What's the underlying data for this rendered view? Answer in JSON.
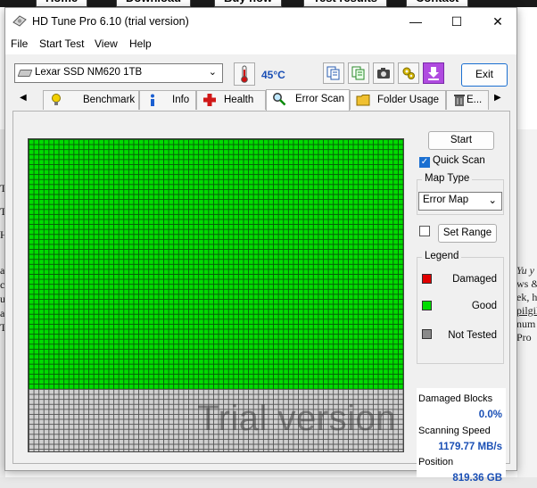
{
  "background": {
    "tabs": [
      "Home",
      "Download",
      "Buy now",
      "Test results",
      "Contact"
    ],
    "right_text": [
      "Yu y",
      "ws &",
      "ek, h",
      "pilgil",
      "num",
      "Pro"
    ],
    "left_text": [
      "T",
      "T",
      "H",
      "a",
      "c",
      "u",
      "a",
      "T"
    ]
  },
  "window": {
    "title": "HD Tune Pro 6.10 (trial version)",
    "controls": {
      "minimize": "—",
      "maximize": "☐",
      "close": "✕"
    }
  },
  "menu": [
    "File",
    "Start Test",
    "View",
    "Help"
  ],
  "toolbar": {
    "drive": "Lexar SSD NM620 1TB",
    "temperature": "45°C",
    "exit_label": "Exit"
  },
  "tabs": [
    {
      "label": "Benchmark",
      "icon": "benchmark-bulb-icon"
    },
    {
      "label": "Info",
      "icon": "info-icon"
    },
    {
      "label": "Health",
      "icon": "health-cross-icon"
    },
    {
      "label": "Error Scan",
      "icon": "magnifier-icon",
      "active": true
    },
    {
      "label": "Folder Usage",
      "icon": "folder-icon"
    },
    {
      "label": "E...",
      "icon": "trash-icon"
    }
  ],
  "error_scan": {
    "start_label": "Start",
    "quick_scan_label": "Quick Scan",
    "quick_scan_checked": true,
    "map_type_label": "Map Type",
    "map_type_value": "Error Map",
    "set_range_label": "Set Range",
    "set_range_checked": false,
    "legend_label": "Legend",
    "legend": [
      {
        "label": "Damaged",
        "color": "#e00000"
      },
      {
        "label": "Good",
        "color": "#00dc00"
      },
      {
        "label": "Not Tested",
        "color": "#8a8a8a"
      }
    ],
    "watermark": "Trial version",
    "scanned_fraction": 0.8,
    "stats": {
      "damaged_label": "Damaged Blocks",
      "damaged_value": "0.0%",
      "speed_label": "Scanning Speed",
      "speed_value": "1179.77 MB/s",
      "position_label": "Position",
      "position_value": "819.36 GB"
    }
  }
}
